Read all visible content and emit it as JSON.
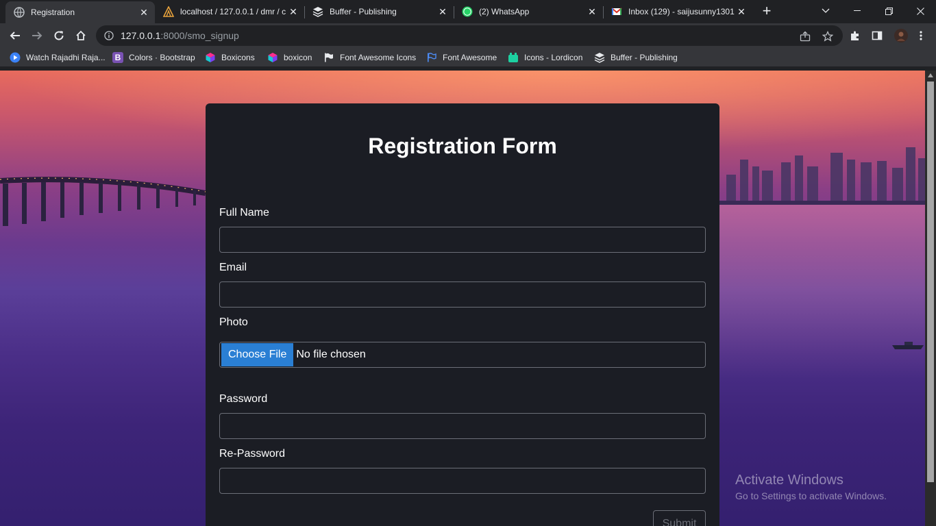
{
  "browser": {
    "tabs": [
      {
        "title": "Registration",
        "active": true,
        "icon": "globe-icon"
      },
      {
        "title": "localhost / 127.0.0.1 / dmr / c",
        "active": false,
        "icon": "phpmyadmin-icon"
      },
      {
        "title": "Buffer - Publishing",
        "active": false,
        "icon": "buffer-icon"
      },
      {
        "title": "(2) WhatsApp",
        "active": false,
        "icon": "whatsapp-icon",
        "badge": "2"
      },
      {
        "title": "Inbox (129) - saijusunny1301",
        "active": false,
        "icon": "gmail-icon"
      }
    ],
    "url": {
      "host": "127.0.0.1",
      "path": ":8000/smo_signup"
    },
    "bookmarks": [
      {
        "label": "Watch Rajadhi Raja...",
        "icon": "play-icon"
      },
      {
        "label": "Colors · Bootstrap",
        "icon": "bootstrap-icon",
        "icon_text": "B"
      },
      {
        "label": "Boxicons",
        "icon": "boxicons-icon"
      },
      {
        "label": "boxicon",
        "icon": "boxicons-icon"
      },
      {
        "label": "Font Awesome Icons",
        "icon": "flag-icon"
      },
      {
        "label": "Font Awesome",
        "icon": "flag-outline-icon"
      },
      {
        "label": "Icons - Lordicon",
        "icon": "lordicon-icon"
      },
      {
        "label": "Buffer - Publishing",
        "icon": "buffer-icon"
      }
    ]
  },
  "form": {
    "title": "Registration Form",
    "fields": {
      "full_name": {
        "label": "Full Name",
        "value": ""
      },
      "email": {
        "label": "Email",
        "value": ""
      },
      "photo": {
        "label": "Photo",
        "button": "Choose File",
        "status": "No file chosen"
      },
      "password": {
        "label": "Password",
        "value": ""
      },
      "re_password": {
        "label": "Re-Password",
        "value": ""
      }
    },
    "submit_label": "Submit"
  },
  "watermark": {
    "title": "Activate Windows",
    "subtitle": "Go to Settings to activate Windows."
  },
  "colors": {
    "card_bg": "#1b1d24",
    "file_button": "#2a7fd4",
    "chrome_dark": "#202124",
    "chrome_toolbar": "#35363a"
  }
}
